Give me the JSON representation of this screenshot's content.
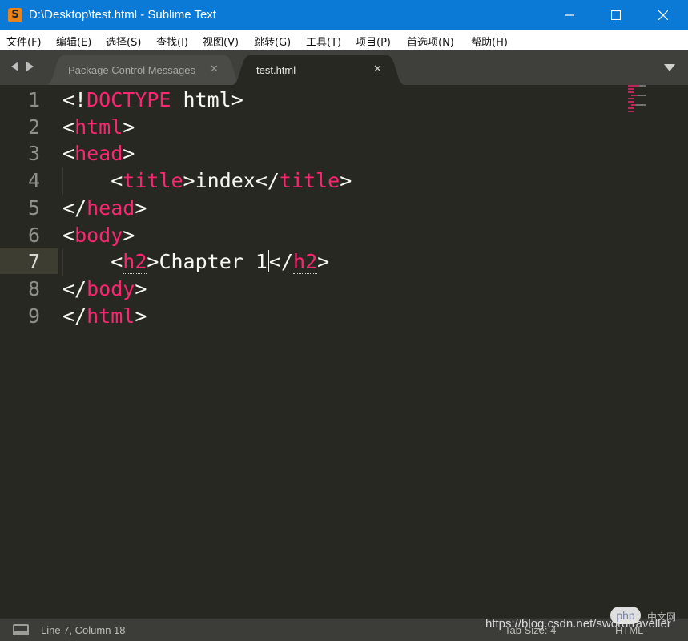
{
  "window": {
    "title": "D:\\Desktop\\test.html - Sublime Text",
    "app_icon_glyph": "S",
    "accent_color": "#0b7ad7"
  },
  "menu": {
    "items": [
      {
        "label": "文件(F)"
      },
      {
        "label": "编辑(E)"
      },
      {
        "label": "选择(S)"
      },
      {
        "label": "查找(I)"
      },
      {
        "label": "视图(V)"
      },
      {
        "label": "跳转(G)"
      },
      {
        "label": "工具(T)"
      },
      {
        "label": "项目(P)"
      },
      {
        "label": "首选项(N)"
      },
      {
        "label": "帮助(H)"
      }
    ]
  },
  "tabs": [
    {
      "label": "Package Control Messages",
      "active": false,
      "close_glyph": "✕"
    },
    {
      "label": "test.html",
      "active": true,
      "close_glyph": "✕"
    }
  ],
  "editor": {
    "background_color": "#272822",
    "tag_color": "#f92672",
    "text_color": "#f8f8f2",
    "line_numbers": [
      "1",
      "2",
      "3",
      "4",
      "5",
      "6",
      "7",
      "8",
      "9"
    ],
    "current_line": 7,
    "lines": [
      {
        "punct_open": "<!",
        "tag": "DOCTYPE",
        "rest": " html>"
      },
      {
        "punct_open": "<",
        "tag": "html",
        "punct_close": ">"
      },
      {
        "punct_open": "<",
        "tag": "head",
        "punct_close": ">"
      },
      {
        "indent": "    ",
        "punct_open": "<",
        "tag": "title",
        "mid": ">index</",
        "tag2": "title",
        "punct_close": ">"
      },
      {
        "punct_open": "</",
        "tag": "head",
        "punct_close": ">"
      },
      {
        "punct_open": "<",
        "tag": "body",
        "punct_close": ">"
      },
      {
        "indent": "    ",
        "punct_open": "<",
        "tag": "h2",
        "mid": ">Chapter 1",
        "mid2": "</",
        "tag2": "h2",
        "punct_close": ">"
      },
      {
        "punct_open": "</",
        "tag": "body",
        "punct_close": ">"
      },
      {
        "punct_open": "</",
        "tag": "html",
        "punct_close": ">"
      }
    ]
  },
  "status": {
    "position": "Line 7, Column 18",
    "tab_size": "Tab Size: 4",
    "syntax": "HTML"
  },
  "watermark": {
    "url": "https://blog.csdn.net/swordtraveller",
    "logo_text": "php",
    "cn_text": "中文网"
  }
}
